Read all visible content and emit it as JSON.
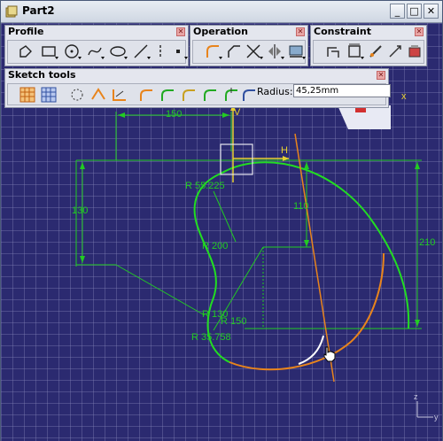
{
  "window": {
    "title": "Part2",
    "minimize": "_",
    "maximize": "□",
    "close": "✕"
  },
  "toolbars": {
    "profile": {
      "title": "Profile",
      "close": "✕"
    },
    "operation": {
      "title": "Operation",
      "close": "✕"
    },
    "constraint": {
      "title": "Constraint",
      "close": "✕"
    },
    "sketch_tools": {
      "title": "Sketch tools",
      "close": "✕",
      "radius_label": "Radius:",
      "radius_value": "45,25mm"
    }
  },
  "dimensions": {
    "d150": "150",
    "d130": "130",
    "d110": "110",
    "d210": "210",
    "r55_225": "R 55.225",
    "r200": "R 200",
    "r130": "R 130",
    "r150": "R 150",
    "r35_758": "R 35.758",
    "axis_v": "V",
    "axis_h": "H",
    "triad_z": "z",
    "triad_y": "y",
    "marker_x": "x"
  },
  "colors": {
    "canvas_bg": "#2b2a70",
    "geometry_green": "#22cc22",
    "construction_orange": "#e8841c",
    "highlight_white": "#ffffff",
    "axis_yellow": "#e8d030"
  }
}
